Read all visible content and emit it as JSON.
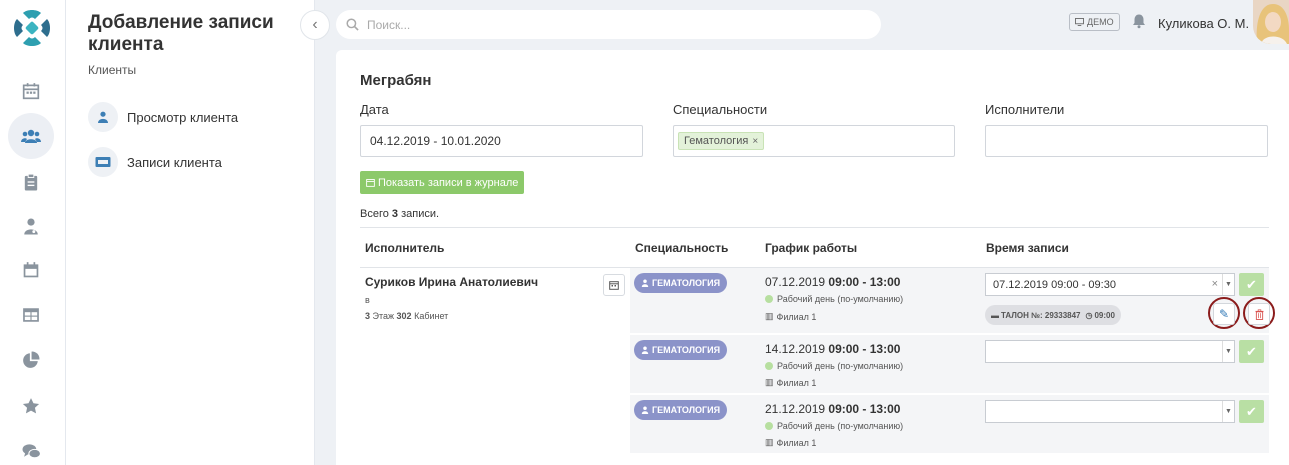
{
  "rail": {
    "items": [
      "calendar-icon",
      "clients-icon",
      "clipboard-icon",
      "doctor-icon",
      "schedule-icon",
      "table-icon",
      "pie-chart-icon",
      "star-icon",
      "chat-icon"
    ],
    "active_index": 1
  },
  "sidebar": {
    "title": "Добавление записи клиента",
    "subtitle": "Клиенты",
    "links": [
      {
        "label": "Просмотр клиента",
        "icon": "user-icon"
      },
      {
        "label": "Записи клиента",
        "icon": "ticket-icon"
      }
    ]
  },
  "topbar": {
    "search_placeholder": "Поиск...",
    "demo_label": "ДЕМО",
    "user_name": "Куликова О. М."
  },
  "main": {
    "client_name": "Меграбян",
    "date_label": "Дата",
    "date_value": "04.12.2019 - 10.01.2020",
    "specialties_label": "Специальности",
    "specialty_tag": "Гематология",
    "executors_label": "Исполнители",
    "show_button": "Показать записи в журнале",
    "total_prefix": "Всего ",
    "total_count": "3",
    "total_suffix": " записи."
  },
  "table": {
    "headers": [
      "Исполнитель",
      "Специальность",
      "График работы",
      "Время записи"
    ],
    "executor": {
      "name": "Суриков Ирина Анатолиевич",
      "line1": "в",
      "floor": "3",
      "floor_label": " Этаж ",
      "room": "302",
      "room_label": " Кабинет"
    },
    "rows": [
      {
        "specialty": "ГЕМАТОЛОГИЯ",
        "date": "07.12.2019",
        "hours": "09:00 - 13:00",
        "workday": "Рабочий день (по-умолчанию)",
        "branch": "Филиал 1",
        "selected_time": "07.12.2019 09:00 - 09:30",
        "ticket": "ТАЛОН №: 29333847",
        "ticket_time": "09:00"
      },
      {
        "specialty": "ГЕМАТОЛОГИЯ",
        "date": "14.12.2019",
        "hours": "09:00 - 13:00",
        "workday": "Рабочий день (по-умолчанию)",
        "branch": "Филиал 1",
        "selected_time": ""
      },
      {
        "specialty": "ГЕМАТОЛОГИЯ",
        "date": "21.12.2019",
        "hours": "09:00 - 13:00",
        "workday": "Рабочий день (по-умолчанию)",
        "branch": "Филиал 1",
        "selected_time": ""
      }
    ]
  },
  "colors": {
    "accent_green": "#8cc96a",
    "specialty_badge": "#8b93c9",
    "highlight_circle": "#8b1c1c",
    "delete_red": "#d9534f",
    "edit_blue": "#337ab7"
  }
}
